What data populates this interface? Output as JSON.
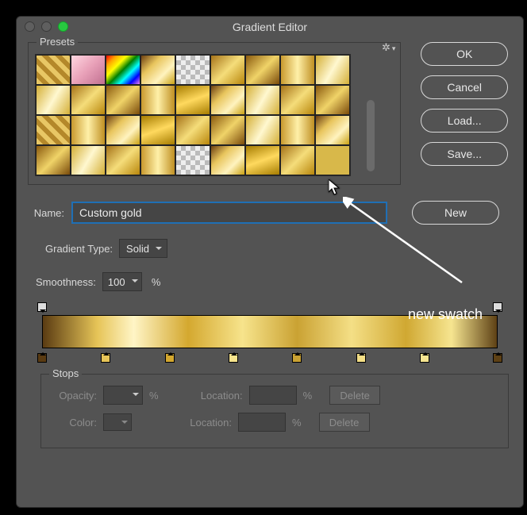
{
  "window": {
    "title": "Gradient Editor"
  },
  "presets": {
    "label": "Presets",
    "gear_name": "gear-icon",
    "swatches": [
      "stripe",
      "pink",
      "rainbow",
      "g1",
      "checker",
      "g2",
      "g3",
      "g4",
      "g5",
      "g5",
      "g2",
      "g3",
      "g4",
      "g6",
      "g1",
      "g5",
      "g2",
      "g3",
      "stripe",
      "g4",
      "g1",
      "g6",
      "g2",
      "g3",
      "g5",
      "g4",
      "g1",
      "g3",
      "g5",
      "g2",
      "g4",
      "checker",
      "g1",
      "g6",
      "g2",
      "solidg"
    ]
  },
  "buttons": {
    "ok": "OK",
    "cancel": "Cancel",
    "load": "Load...",
    "save": "Save...",
    "new": "New"
  },
  "name": {
    "label": "Name:",
    "value": "Custom gold"
  },
  "gradient_type": {
    "label": "Gradient Type:",
    "value": "Solid"
  },
  "smoothness": {
    "label": "Smoothness:",
    "value": "100",
    "unit": "%"
  },
  "gradient": {
    "opacity_stops": [
      0,
      100
    ],
    "color_stops": [
      {
        "pos": 0,
        "color": "#5a3b12"
      },
      {
        "pos": 14,
        "color": "#e6c457"
      },
      {
        "pos": 28,
        "color": "#d4a82f"
      },
      {
        "pos": 42,
        "color": "#f7e48c"
      },
      {
        "pos": 56,
        "color": "#caa233"
      },
      {
        "pos": 70,
        "color": "#f4df86"
      },
      {
        "pos": 84,
        "color": "#f6e590"
      },
      {
        "pos": 100,
        "color": "#5e4115"
      }
    ]
  },
  "stops": {
    "label": "Stops",
    "opacity_label": "Opacity:",
    "pct": "%",
    "location_label": "Location:",
    "delete": "Delete",
    "color_label": "Color:"
  },
  "annotation": {
    "label": "new swatch"
  }
}
